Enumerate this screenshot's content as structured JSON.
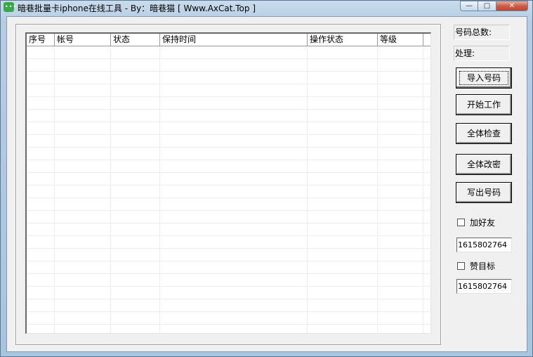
{
  "window": {
    "title": "暗巷批量卡iphone在线工具 - By：暗巷猫 [ Www.AxCat.Top ]",
    "controls": {
      "minimize": "—",
      "maximize": "□",
      "close": "✕"
    }
  },
  "list": {
    "columns": [
      "序号",
      "帐号",
      "状态",
      "保持时间",
      "操作状态",
      "等级"
    ],
    "rows": []
  },
  "side": {
    "total_label": "号码总数:",
    "process_label": "处理:",
    "buttons": [
      "导入号码",
      "开始工作",
      "全体检查",
      "全体改密",
      "写出号码"
    ],
    "add_friend": {
      "label": "加好友",
      "checked": false,
      "value": "1615802764"
    },
    "like_target": {
      "label": "赞目标",
      "checked": false,
      "value": "1615802764"
    }
  }
}
